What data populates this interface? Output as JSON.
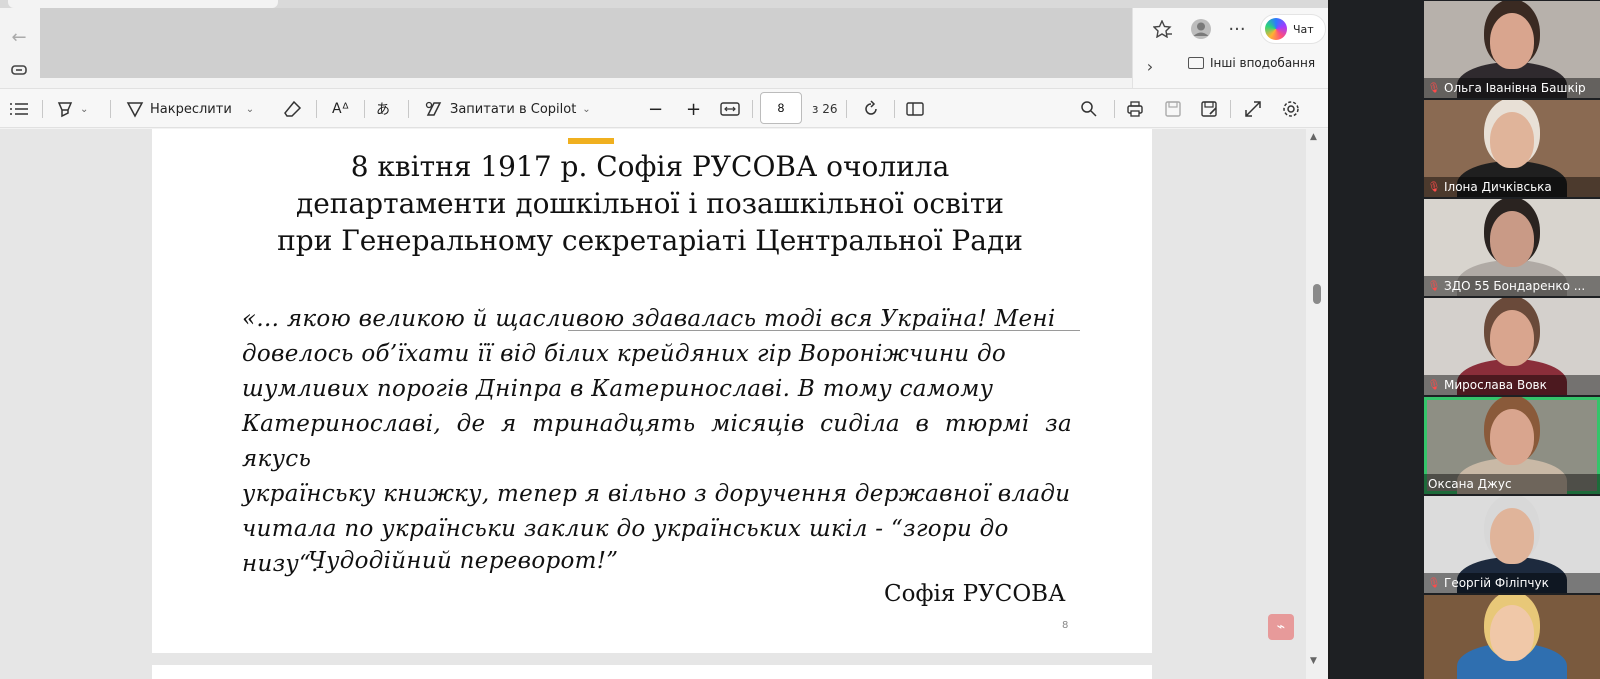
{
  "browser": {
    "copilot_label": "Чат",
    "favorites_label": "Інші вподобання"
  },
  "pdf_toolbar": {
    "draw_label": "Накреслити",
    "ask_copilot_label": "Запитати в Copilot",
    "page_current": "8",
    "page_total_label": "з 26"
  },
  "slide": {
    "title_lines": [
      "8 квітня 1917 р. Софія РУСОВА очолила",
      "департаменти дошкільної і позашкільної освіти",
      "при Генеральному секретаріаті Центральної Ради"
    ],
    "quote_lines": [
      "«... якою великою й щасливою здавалась тоді вся Україна! Мені",
      "довелось об’їхати її від білих крейдяних гір Вороніжчини до",
      "шумливих порогів Дніпра в Катеринославі. В тому самому",
      "Катеринославі, де я тринадцять місяців сиділа в тюрмі за якусь",
      "українську книжку, тепер я вільно з доручення державної влади",
      "читала по українськи заклик до українських шкіл - “згори до",
      "низу“."
    ],
    "quote_end": "Чудодійний переворот!”",
    "author": "Софія РУСОВА",
    "page_number": "8"
  },
  "participants": [
    {
      "name": "Ольга Іванівна Башкір",
      "muted": true,
      "active": false,
      "bg": "#b7b1ab",
      "skin": "#d9a58e",
      "hair": "#3a2a22",
      "cloth": "#2f2a2e"
    },
    {
      "name": "Ілона Дичківська",
      "muted": true,
      "active": false,
      "bg": "#8a6a52",
      "skin": "#e0b49a",
      "hair": "#e8e0d6",
      "cloth": "#1f1f1f"
    },
    {
      "name": "ЗДО 55 Бондаренко ...",
      "muted": true,
      "active": false,
      "bg": "#d8d4ce",
      "skin": "#c99a86",
      "hair": "#2a2320",
      "cloth": "#b0aaa5"
    },
    {
      "name": "Мирослава Вовк",
      "muted": true,
      "active": false,
      "bg": "#d4d0cc",
      "skin": "#d9a58e",
      "hair": "#6a4a3a",
      "cloth": "#8a2e3a"
    },
    {
      "name": "Оксана Джус",
      "muted": false,
      "active": true,
      "bg": "#8e8f84",
      "skin": "#d9a58e",
      "hair": "#8a5a3a",
      "cloth": "#c9b9a6"
    },
    {
      "name": "Георгій Філіпчук",
      "muted": true,
      "active": false,
      "bg": "#dcdcdc",
      "skin": "#e0b49a",
      "hair": "#d8d8d8",
      "cloth": "#1d2a3e"
    },
    {
      "name": "",
      "muted": false,
      "active": false,
      "bg": "#7a5a3e",
      "skin": "#f0c8a8",
      "hair": "#e8c878",
      "cloth": "#2f6fb0"
    }
  ]
}
